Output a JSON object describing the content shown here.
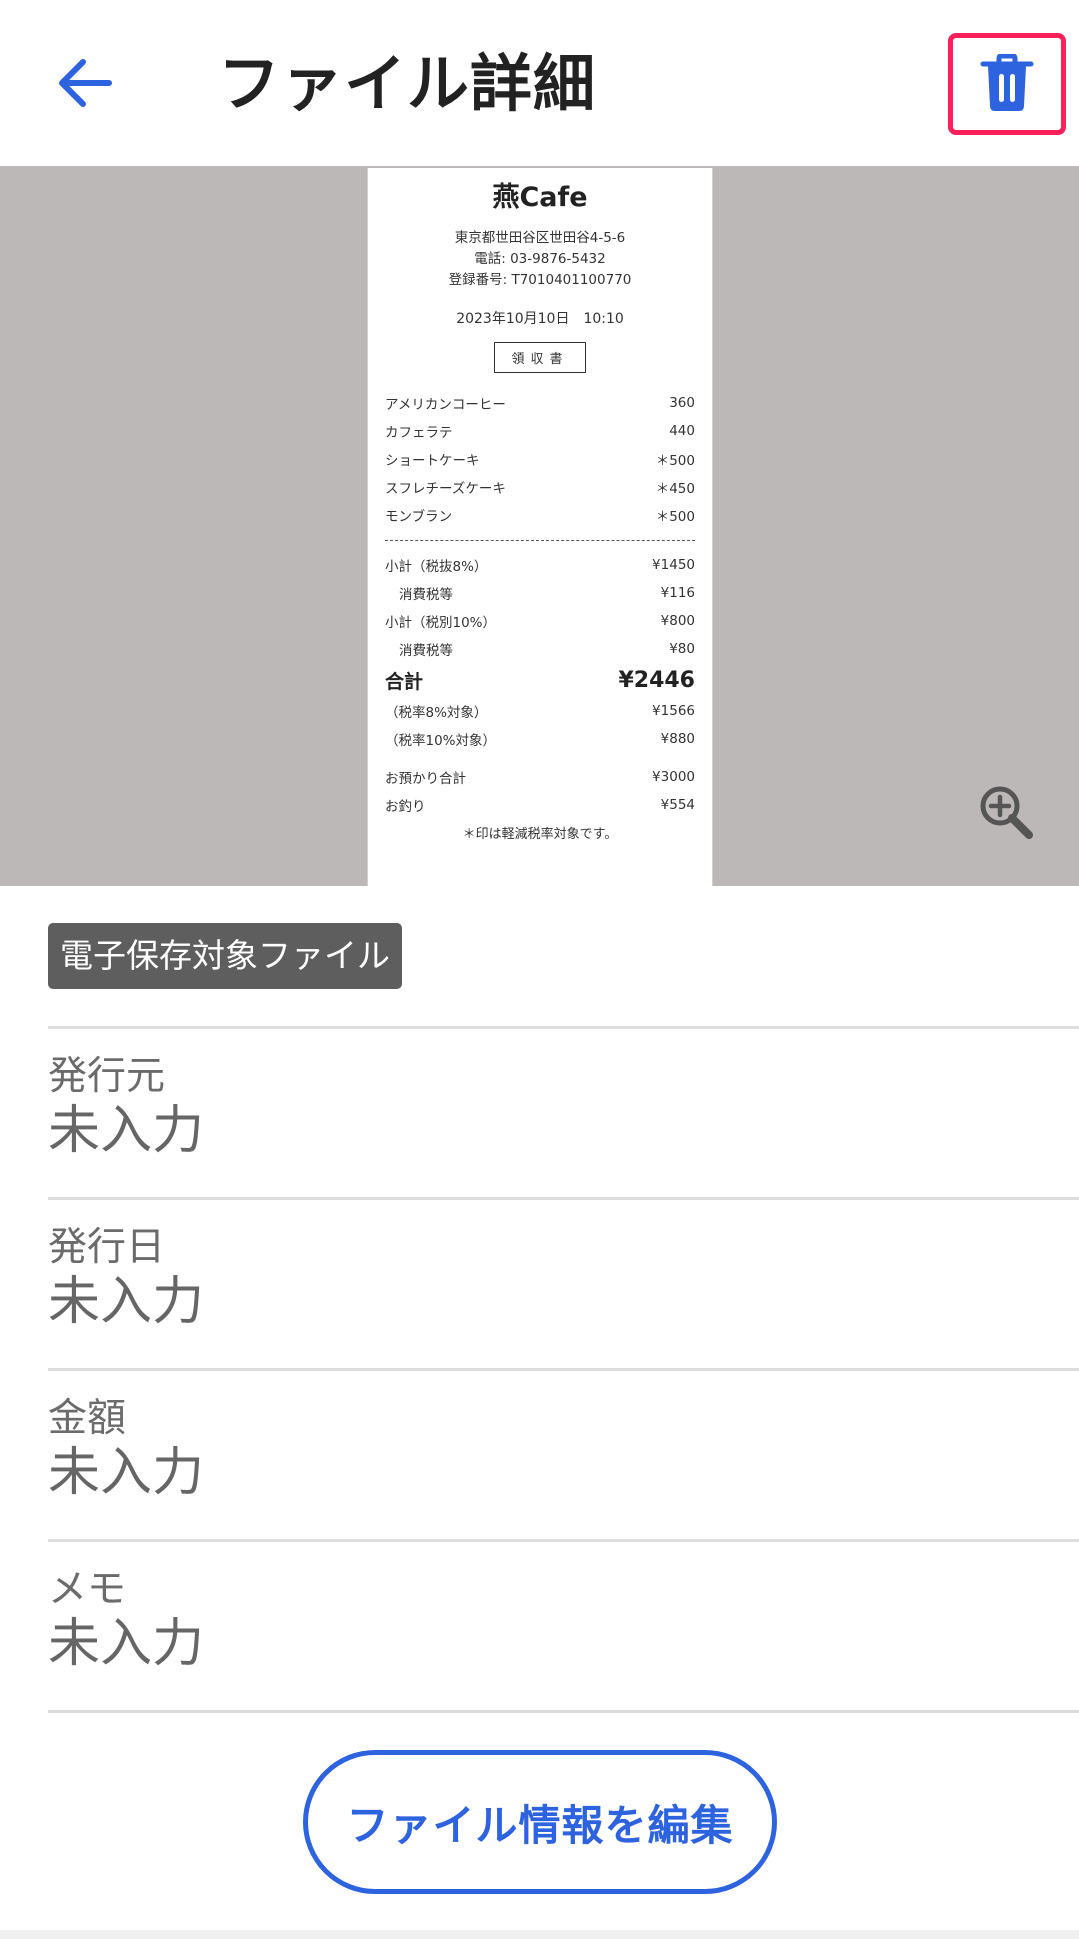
{
  "header": {
    "title": "ファイル詳細"
  },
  "receipt": {
    "shop_name": "燕Cafe",
    "address": "東京都世田谷区世田谷4-5-6",
    "phone": "電話: 03-9876-5432",
    "registration": "登録番号: T7010401100770",
    "datetime": "2023年10月10日　10:10",
    "doc_label": "領収書",
    "items": [
      {
        "name": "アメリカンコーヒー",
        "price": "360"
      },
      {
        "name": "カフェラテ",
        "price": "440"
      },
      {
        "name": "ショートケーキ",
        "price": "＊500"
      },
      {
        "name": "スフレチーズケーキ",
        "price": "＊450"
      },
      {
        "name": "モンブラン",
        "price": "＊500"
      }
    ],
    "subtotal_8_label": "小計（税抜8%）",
    "subtotal_8": "¥1450",
    "tax_8_label": "消費税等",
    "tax_8": "¥116",
    "subtotal_10_label": "小計（税別10%）",
    "subtotal_10": "¥800",
    "tax_10_label": "消費税等",
    "tax_10": "¥80",
    "total_label": "合計",
    "total": "¥2446",
    "target_8_label": "（税率8%対象）",
    "target_8": "¥1566",
    "target_10_label": "（税率10%対象）",
    "target_10": "¥880",
    "received_label": "お預かり合計",
    "received": "¥3000",
    "change_label": "お釣り",
    "change": "¥554",
    "note": "＊印は軽減税率対象です。"
  },
  "badge": {
    "text": "電子保存対象ファイル"
  },
  "fields": [
    {
      "label": "発行元",
      "value": "未入力"
    },
    {
      "label": "発行日",
      "value": "未入力"
    },
    {
      "label": "金額",
      "value": "未入力"
    },
    {
      "label": "メモ",
      "value": "未入力"
    }
  ],
  "edit_button": {
    "label": "ファイル情報を編集"
  },
  "icons": {
    "back": "arrow-left-icon",
    "trash": "trash-icon",
    "zoom": "zoom-in-icon"
  },
  "colors": {
    "accent": "#2e63e0",
    "highlight": "#ff1f5a",
    "badge_bg": "#5e5e5e",
    "preview_bg": "#bcb8b8"
  }
}
